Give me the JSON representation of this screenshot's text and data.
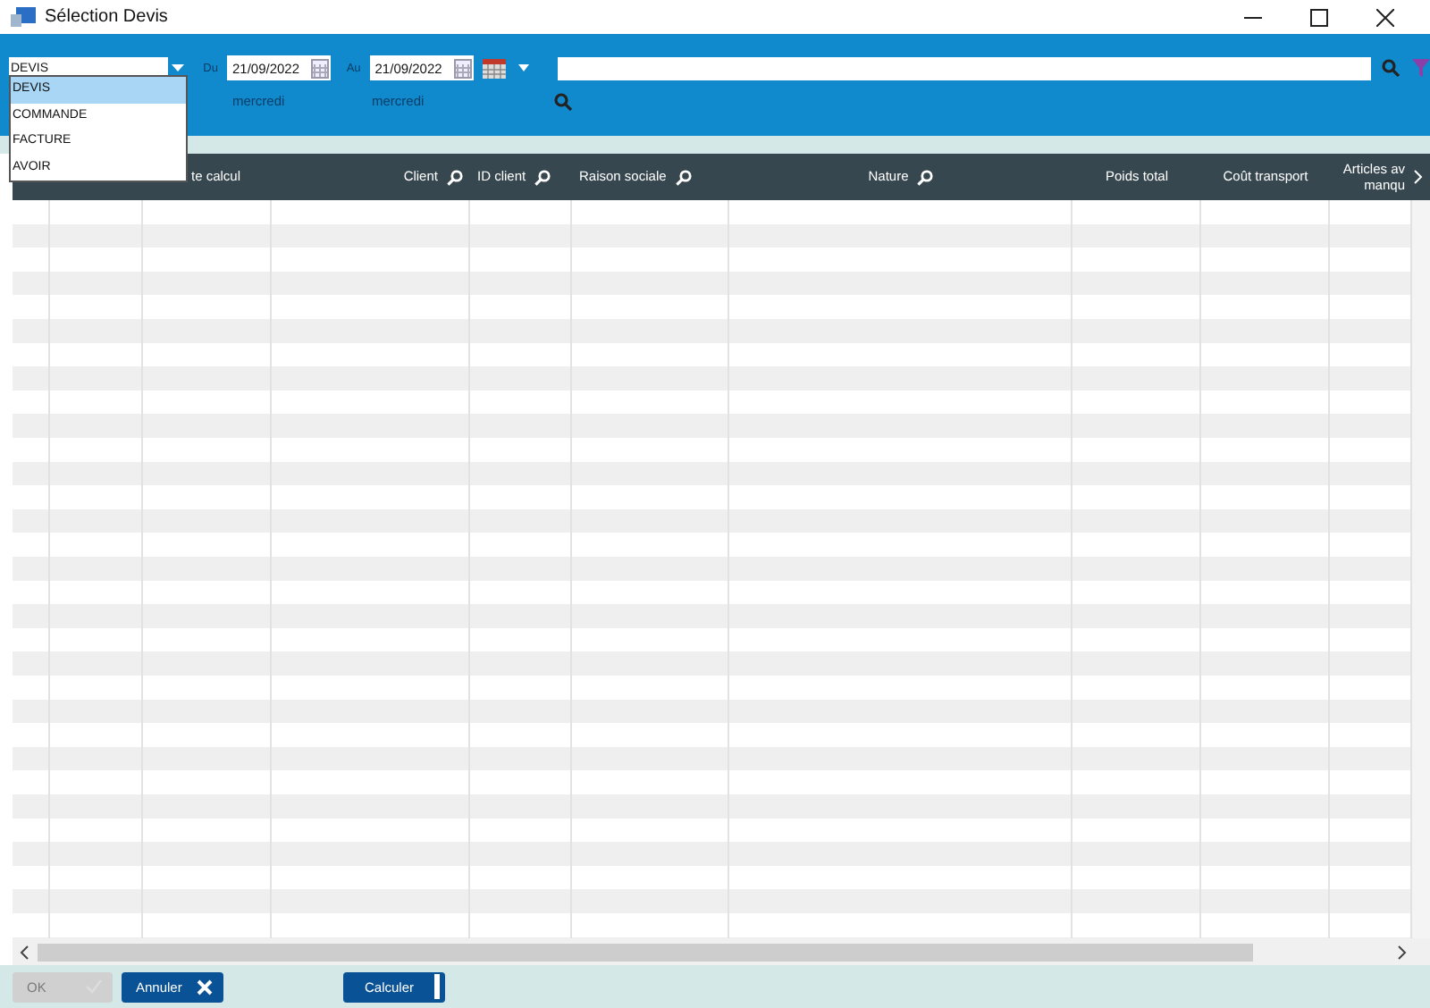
{
  "window": {
    "title": "Sélection Devis"
  },
  "toolbar": {
    "document_type": {
      "value": "DEVIS",
      "expanded": true,
      "options": [
        {
          "label": "DEVIS",
          "selected": true
        },
        {
          "label": "COMMANDE",
          "selected": false
        },
        {
          "label": "FACTURE",
          "selected": false
        },
        {
          "label": "AVOIR",
          "selected": false
        }
      ]
    },
    "from": {
      "label": "Du",
      "value": "21/09/2022",
      "day": "mercredi"
    },
    "to": {
      "label": "Au",
      "value": "21/09/2022",
      "day": "mercredi"
    }
  },
  "table": {
    "columns": [
      {},
      {},
      {
        "label": "te calcul"
      },
      {
        "label": "Client",
        "searchable": true
      },
      {
        "label": "ID client",
        "searchable": true
      },
      {
        "label": "Raison sociale",
        "searchable": true
      },
      {
        "label": "Nature",
        "searchable": true
      },
      {
        "label": "Poids total"
      },
      {
        "label": "Coût transport"
      },
      {
        "label": "Articles av\nmanqu"
      }
    ]
  },
  "buttons": [
    {
      "label": "OK",
      "kind": "ok",
      "disabled": true
    },
    {
      "label": "Annuler",
      "kind": "cancel",
      "disabled": false
    },
    {
      "label": "Calculer",
      "kind": "calc",
      "disabled": false
    }
  ]
}
